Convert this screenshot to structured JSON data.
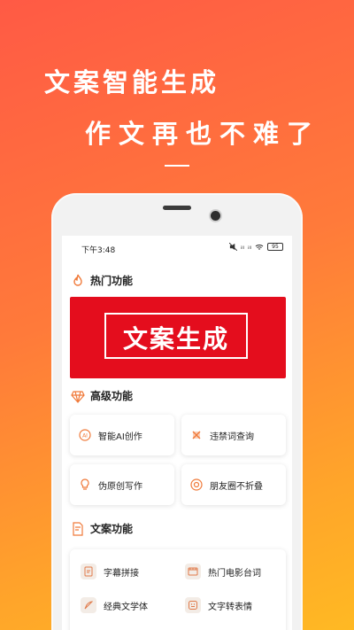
{
  "hero": {
    "headline": "文案智能生成",
    "subline": "作文再也不难了"
  },
  "status_bar": {
    "time": "下午3:48",
    "signal_1": "ᵢₗₗ",
    "signal_2": "ᵢₗₗ",
    "battery": "95"
  },
  "sections": {
    "hot": {
      "title": "热门功能"
    },
    "premium": {
      "title": "高级功能"
    },
    "copy": {
      "title": "文案功能"
    }
  },
  "banner": {
    "text": "文案生成"
  },
  "premium_cards": [
    {
      "label": "智能AI创作",
      "icon": "ai-icon"
    },
    {
      "label": "违禁词查询",
      "icon": "ban-icon"
    },
    {
      "label": "伪原创写作",
      "icon": "lightbulb-icon"
    },
    {
      "label": "朋友圈不折叠",
      "icon": "camera-lens-icon"
    }
  ],
  "copy_items": [
    {
      "label": "字幕拼接",
      "icon": "subtitle-icon"
    },
    {
      "label": "热门电影台词",
      "icon": "film-icon"
    },
    {
      "label": "经典文学体",
      "icon": "feather-icon"
    },
    {
      "label": "文字转表情",
      "icon": "emoji-icon"
    }
  ],
  "colors": {
    "accent": "#ff6a3d",
    "banner": "#e40d1d",
    "icon_orange": "#f07a3a"
  }
}
